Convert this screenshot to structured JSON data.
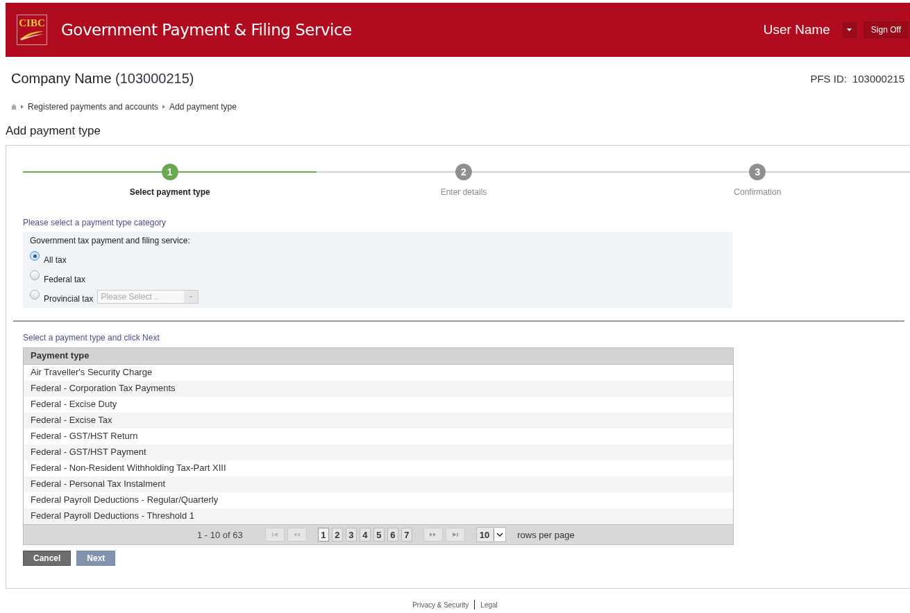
{
  "header": {
    "logo": "CIBC",
    "title": "Government Payment & Filing Service",
    "user": "User Name",
    "sign_off": "Sign Off"
  },
  "company": {
    "name": "Company Name",
    "id": "(103000215)",
    "pfs_label": "PFS ID:",
    "pfs_id": "103000215"
  },
  "breadcrumb": [
    "Registered payments and accounts",
    "Add payment type"
  ],
  "page_title": "Add payment type",
  "steps": [
    {
      "number": "1",
      "label": "Select payment type",
      "selected": true
    },
    {
      "number": "2",
      "label": "Enter details",
      "selected": false
    },
    {
      "number": "3",
      "label": "Confirmation",
      "selected": false
    }
  ],
  "category": {
    "heading": "Please select a payment type category",
    "group_label": "Government tax payment and filing service:",
    "options": [
      {
        "label": "All tax",
        "selected": true
      },
      {
        "label": "Federal tax",
        "selected": false
      },
      {
        "label": "Provincial tax",
        "selected": false,
        "dropdown": {
          "placeholder": "Please Select ..",
          "disabled": true
        }
      }
    ]
  },
  "table": {
    "heading": "Select a payment type and click Next",
    "columns": [
      "Payment type"
    ],
    "rows": [
      "Air Traveller's Security Charge",
      "Federal - Corporation Tax Payments",
      "Federal - Excise Duty",
      "Federal - Excise Tax",
      "Federal - GST/HST Return",
      "Federal - GST/HST Payment",
      "Federal - Non-Resident Withholding Tax-Part XIII",
      "Federal - Personal Tax Instalment",
      "Federal Payroll Deductions - Regular/Quarterly",
      "Federal Payroll Deductions - Threshold 1"
    ]
  },
  "pager": {
    "range": "1 - 10 of 63",
    "pages": [
      {
        "label": "1",
        "selected": true
      },
      {
        "label": "2",
        "selected": false
      },
      {
        "label": "3",
        "selected": false
      },
      {
        "label": "4",
        "selected": false
      },
      {
        "label": "5",
        "selected": false
      },
      {
        "label": "6",
        "selected": false
      },
      {
        "label": "7",
        "selected": false
      }
    ],
    "rows_per_page": "10",
    "rows_label": "rows per page"
  },
  "buttons": [
    {
      "label": "Cancel",
      "kind": "secondary"
    },
    {
      "label": "Next",
      "kind": "primary"
    }
  ],
  "footer": [
    "Privacy & Security",
    "Legal"
  ]
}
